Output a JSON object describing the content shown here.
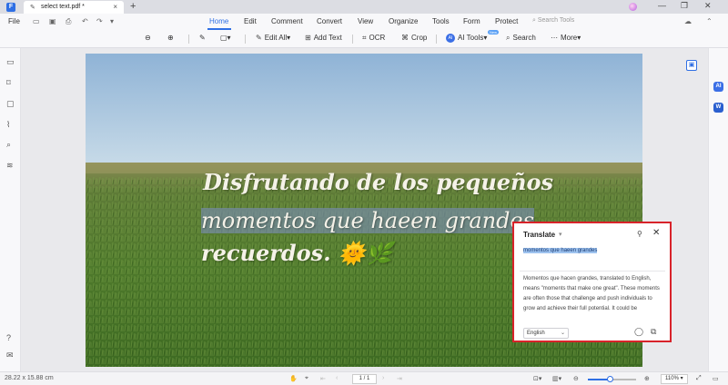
{
  "titlebar": {
    "logo": "F",
    "tab_icon": "✎",
    "tab_title": "select text.pdf *",
    "tab_close": "×",
    "new_tab": "+",
    "window_buttons": [
      "—",
      "❐",
      "✕"
    ]
  },
  "menu": {
    "file": "File",
    "items": [
      "Home",
      "Edit",
      "Comment",
      "Convert",
      "View",
      "Organize",
      "Tools",
      "Form",
      "Protect"
    ],
    "active": "Home",
    "search_tools": "Search Tools",
    "accent": "#2f6fe4"
  },
  "toolbar": {
    "edit_all": "Edit All",
    "add_text": "Add Text",
    "ocr": "OCR",
    "crop": "Crop",
    "ai_tools": "AI Tools",
    "ai_badge": "AI",
    "new_badge": "New",
    "search": "Search",
    "more": "More"
  },
  "right_panel": {
    "ai_label": "AI",
    "word_label": "W"
  },
  "document": {
    "line1": "Disfrutando de los pequeños",
    "line2": "momentos que haeen grandes",
    "line3": "recuerdos.",
    "emoji_sun": "🌞",
    "emoji_herb": "🌿"
  },
  "translate": {
    "title": "Translate",
    "source_text": "momentos que haeen grandes",
    "result": "Momentos que hacen grandes, translated to English, means \"moments that make one great\". These moments are often those that challenge and push individuals to grow and achieve their full potential. It could be overcoming a difficult task, accomplishing a",
    "language": "English",
    "highlight_color": "#9ec3ef",
    "border_color": "#d8232a"
  },
  "statusbar": {
    "dimensions": "28.22 x 15.88 cm",
    "page": "1 / 1",
    "zoom": "110%",
    "zoom_level": 0.45
  }
}
